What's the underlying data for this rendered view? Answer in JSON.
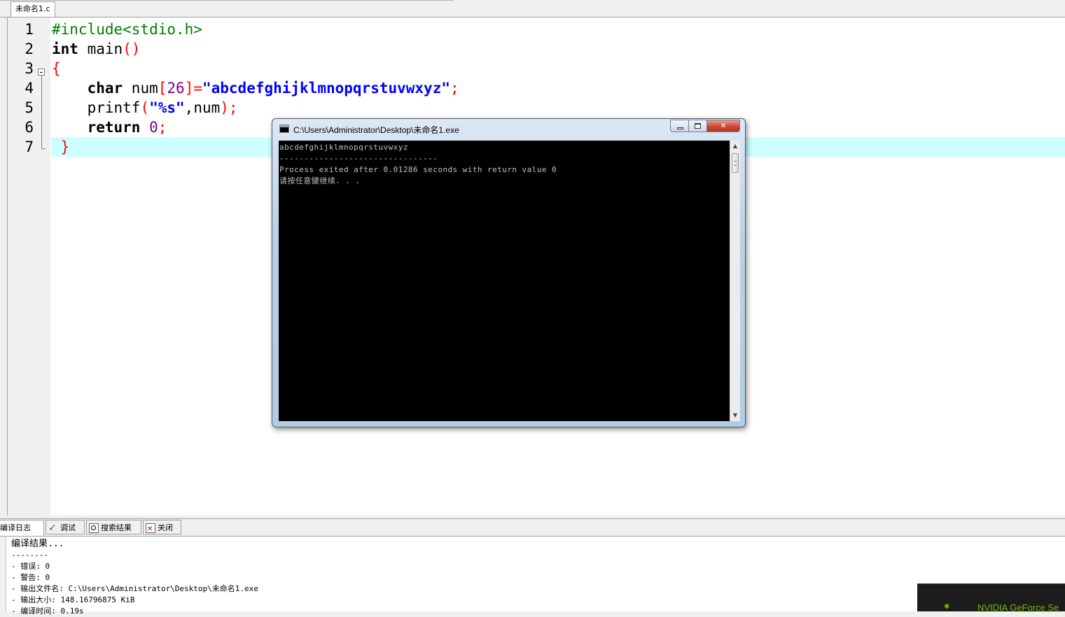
{
  "editor": {
    "tab_label": "未命名1.c",
    "current_line": 7,
    "lines": [
      {
        "num": "1",
        "tokens": [
          {
            "t": "#include<stdio.h>",
            "c": "pp"
          }
        ]
      },
      {
        "num": "2",
        "tokens": [
          {
            "t": "int",
            "c": "kw"
          },
          {
            "t": " main",
            "c": "plain"
          },
          {
            "t": "()",
            "c": "br"
          }
        ]
      },
      {
        "num": "3",
        "tokens": [
          {
            "t": "{",
            "c": "br"
          }
        ]
      },
      {
        "num": "4",
        "tokens": [
          {
            "t": "    ",
            "c": "plain"
          },
          {
            "t": "char",
            "c": "kw"
          },
          {
            "t": " num",
            "c": "plain"
          },
          {
            "t": "[",
            "c": "br"
          },
          {
            "t": "26",
            "c": "num-lit"
          },
          {
            "t": "]=",
            "c": "br"
          },
          {
            "t": "\"abcdefghijklmnopqrstuvwxyz\"",
            "c": "str"
          },
          {
            "t": ";",
            "c": "br"
          }
        ]
      },
      {
        "num": "5",
        "tokens": [
          {
            "t": "    printf",
            "c": "plain"
          },
          {
            "t": "(",
            "c": "br"
          },
          {
            "t": "\"%s\"",
            "c": "str"
          },
          {
            "t": ",num",
            "c": "plain"
          },
          {
            "t": ");",
            "c": "br"
          }
        ]
      },
      {
        "num": "6",
        "tokens": [
          {
            "t": "    ",
            "c": "plain"
          },
          {
            "t": "return",
            "c": "kw"
          },
          {
            "t": " ",
            "c": "plain"
          },
          {
            "t": "0",
            "c": "num-lit"
          },
          {
            "t": ";",
            "c": "br"
          }
        ]
      },
      {
        "num": "7",
        "tokens": [
          {
            "t": " }",
            "c": "br"
          }
        ]
      }
    ]
  },
  "console": {
    "title": "C:\\Users\\Administrator\\Desktop\\未命名1.exe",
    "output": "abcdefghijklmnopqrstuvwxyz\n--------------------------------\nProcess exited after 0.01286 seconds with return value 0\n请按任意键继续. . ."
  },
  "bottom": {
    "tabs": [
      {
        "label": "编译日志",
        "icon": "compile-log-icon",
        "active": true
      },
      {
        "label": "调试",
        "icon": "check-icon",
        "active": false
      },
      {
        "label": "搜索结果",
        "icon": "search-icon",
        "active": false
      },
      {
        "label": "关闭",
        "icon": "close-icon",
        "active": false
      }
    ],
    "log_title": "编译结果...",
    "log_lines": "--------\n- 错误: 0\n- 警告: 0\n- 输出文件名: C:\\Users\\Administrator\\Desktop\\未命名1.exe\n- 输出大小: 148.16796875 KiB\n- 编译时间: 0.19s"
  },
  "notification": {
    "text": "NVIDIA GeForce Se"
  }
}
